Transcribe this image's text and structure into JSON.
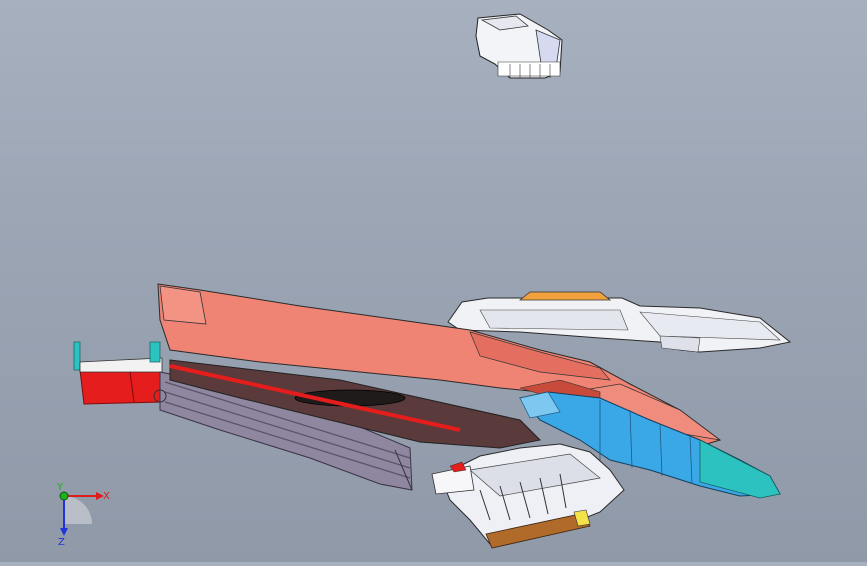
{
  "viewport": {
    "background_top": "#a6b0bf",
    "background_bottom": "#8f99a8"
  },
  "colors": {
    "red_panel": "#e8796a",
    "red_dark": "#c84a3a",
    "bright_red": "#e51d1d",
    "purple_gray": "#8f86a0",
    "cyan": "#3aa7e6",
    "teal": "#2bc2c0",
    "white_part": "#eef0f5",
    "orange": "#f4a23a",
    "brown": "#b06a2a"
  },
  "triad": {
    "x_label": "X",
    "y_label": "Y",
    "z_label": "Z",
    "x_color": "#e01b1b",
    "y_color": "#1bb21b",
    "z_color": "#2233dd",
    "icons": [
      "axis-x-icon",
      "axis-y-icon",
      "axis-z-icon"
    ]
  }
}
